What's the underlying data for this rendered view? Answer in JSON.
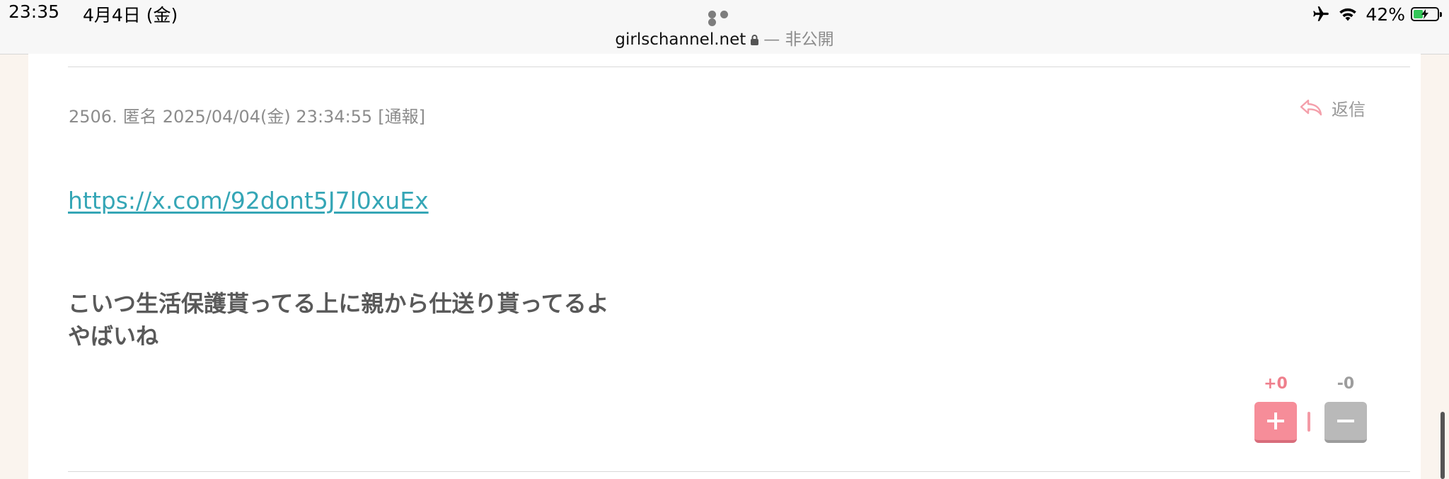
{
  "status_bar": {
    "time": "23:35",
    "date": "4月4日 (金)",
    "battery_percent": "42%",
    "battery_level": 0.42,
    "url": "girlschannel.net",
    "url_suffix": "— 非公開"
  },
  "post": {
    "number": "2506.",
    "author": "匿名",
    "timestamp": "2025/04/04(金) 23:34:55",
    "report_label": "[通報]",
    "reply_label": "返信",
    "link_text": "https://x.com/92dont5J7l0xuEx",
    "body_lines": [
      "こいつ生活保護貰ってる上に親から仕送り貰ってるよ",
      "やばいね"
    ],
    "votes": {
      "plus_count": "+0",
      "minus_count": "-0"
    }
  },
  "colors": {
    "accent_link": "#35a6b6",
    "plus_button": "#f68d99",
    "minus_button": "#b9b9b9",
    "battery_fill": "#34c759"
  },
  "icons": {
    "more": "more-dots-icon",
    "lock": "lock-icon",
    "airplane": "airplane-icon",
    "wifi": "wifi-icon",
    "battery": "battery-charging-icon",
    "reply": "reply-arrow-icon",
    "plus": "plus-icon",
    "minus": "minus-icon"
  }
}
